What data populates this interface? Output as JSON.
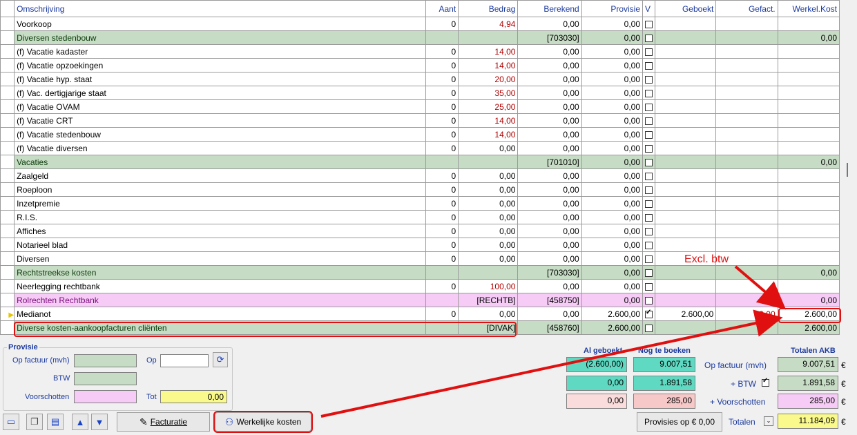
{
  "columns": [
    "Omschrijving",
    "Aant",
    "Bedrag",
    "Berekend",
    "Provisie",
    "V",
    "Geboekt",
    "Gefact.",
    "Werkel.Kost"
  ],
  "rows": [
    {
      "type": "normal",
      "desc": "Voorkoop",
      "aant": "0",
      "bedrag": "4,94",
      "bedrag_red": true,
      "berekend": "0,00",
      "provisie": "0,00",
      "v": false,
      "geboekt": "",
      "gefact": "",
      "werkel": ""
    },
    {
      "type": "cat",
      "desc": "Diversen stedenbouw",
      "aant": "",
      "bedrag": "",
      "berekend": "[703030]",
      "provisie": "0,00",
      "v": false,
      "geboekt": "",
      "gefact": "",
      "werkel": "0,00"
    },
    {
      "type": "normal",
      "desc": "(f) Vacatie kadaster",
      "aant": "0",
      "bedrag": "14,00",
      "bedrag_red": true,
      "berekend": "0,00",
      "provisie": "0,00",
      "v": false,
      "geboekt": "",
      "gefact": "",
      "werkel": ""
    },
    {
      "type": "normal",
      "desc": "(f) Vacatie opzoekingen",
      "aant": "0",
      "bedrag": "14,00",
      "bedrag_red": true,
      "berekend": "0,00",
      "provisie": "0,00",
      "v": false,
      "geboekt": "",
      "gefact": "",
      "werkel": ""
    },
    {
      "type": "normal",
      "desc": "(f) Vacatie hyp. staat",
      "aant": "0",
      "bedrag": "20,00",
      "bedrag_red": true,
      "berekend": "0,00",
      "provisie": "0,00",
      "v": false,
      "geboekt": "",
      "gefact": "",
      "werkel": ""
    },
    {
      "type": "normal",
      "desc": "(f) Vac. dertigjarige staat",
      "aant": "0",
      "bedrag": "35,00",
      "bedrag_red": true,
      "berekend": "0,00",
      "provisie": "0,00",
      "v": false,
      "geboekt": "",
      "gefact": "",
      "werkel": ""
    },
    {
      "type": "normal",
      "desc": "(f) Vacatie OVAM",
      "aant": "0",
      "bedrag": "25,00",
      "bedrag_red": true,
      "berekend": "0,00",
      "provisie": "0,00",
      "v": false,
      "geboekt": "",
      "gefact": "",
      "werkel": ""
    },
    {
      "type": "normal",
      "desc": "(f) Vacatie CRT",
      "aant": "0",
      "bedrag": "14,00",
      "bedrag_red": true,
      "berekend": "0,00",
      "provisie": "0,00",
      "v": false,
      "geboekt": "",
      "gefact": "",
      "werkel": ""
    },
    {
      "type": "normal",
      "desc": "(f) Vacatie stedenbouw",
      "aant": "0",
      "bedrag": "14,00",
      "bedrag_red": true,
      "berekend": "0,00",
      "provisie": "0,00",
      "v": false,
      "geboekt": "",
      "gefact": "",
      "werkel": ""
    },
    {
      "type": "normal",
      "desc": "(f) Vacatie diversen",
      "aant": "0",
      "bedrag": "0,00",
      "bedrag_red": false,
      "berekend": "0,00",
      "provisie": "0,00",
      "v": false,
      "geboekt": "",
      "gefact": "",
      "werkel": ""
    },
    {
      "type": "cat",
      "desc": "Vacaties",
      "aant": "",
      "bedrag": "",
      "berekend": "[701010]",
      "provisie": "0,00",
      "v": false,
      "geboekt": "",
      "gefact": "",
      "werkel": "0,00"
    },
    {
      "type": "normal",
      "desc": "Zaalgeld",
      "aant": "0",
      "bedrag": "0,00",
      "bedrag_red": false,
      "berekend": "0,00",
      "provisie": "0,00",
      "v": false,
      "geboekt": "",
      "gefact": "",
      "werkel": ""
    },
    {
      "type": "normal",
      "desc": "Roeploon",
      "aant": "0",
      "bedrag": "0,00",
      "bedrag_red": false,
      "berekend": "0,00",
      "provisie": "0,00",
      "v": false,
      "geboekt": "",
      "gefact": "",
      "werkel": ""
    },
    {
      "type": "normal",
      "desc": "Inzetpremie",
      "aant": "0",
      "bedrag": "0,00",
      "bedrag_red": false,
      "berekend": "0,00",
      "provisie": "0,00",
      "v": false,
      "geboekt": "",
      "gefact": "",
      "werkel": ""
    },
    {
      "type": "normal",
      "desc": "R.I.S.",
      "aant": "0",
      "bedrag": "0,00",
      "bedrag_red": false,
      "berekend": "0,00",
      "provisie": "0,00",
      "v": false,
      "geboekt": "",
      "gefact": "",
      "werkel": ""
    },
    {
      "type": "normal",
      "desc": "Affiches",
      "aant": "0",
      "bedrag": "0,00",
      "bedrag_red": false,
      "berekend": "0,00",
      "provisie": "0,00",
      "v": false,
      "geboekt": "",
      "gefact": "",
      "werkel": ""
    },
    {
      "type": "normal",
      "desc": "Notarieel blad",
      "aant": "0",
      "bedrag": "0,00",
      "bedrag_red": false,
      "berekend": "0,00",
      "provisie": "0,00",
      "v": false,
      "geboekt": "",
      "gefact": "",
      "werkel": ""
    },
    {
      "type": "normal",
      "desc": "Diversen",
      "aant": "0",
      "bedrag": "0,00",
      "bedrag_red": false,
      "berekend": "0,00",
      "provisie": "0,00",
      "v": false,
      "geboekt": "",
      "gefact": "",
      "werkel": ""
    },
    {
      "type": "cat",
      "desc": "Rechtstreekse kosten",
      "aant": "",
      "bedrag": "",
      "berekend": "[703030]",
      "provisie": "0,00",
      "v": false,
      "geboekt": "",
      "gefact": "",
      "werkel": "0,00"
    },
    {
      "type": "normal",
      "desc": "Neerlegging rechtbank",
      "aant": "0",
      "bedrag": "100,00",
      "bedrag_red": true,
      "berekend": "0,00",
      "provisie": "0,00",
      "v": false,
      "geboekt": "",
      "gefact": "",
      "werkel": ""
    },
    {
      "type": "pink",
      "desc": "Rolrechten Rechtbank",
      "aant": "",
      "bedrag": "[RECHTB]",
      "berekend": "[458750]",
      "provisie": "0,00",
      "v": false,
      "geboekt": "",
      "gefact": "",
      "werkel": "0,00"
    },
    {
      "type": "current",
      "desc": "Medianot",
      "aant": "0",
      "bedrag": "0,00",
      "bedrag_red": false,
      "berekend": "0,00",
      "provisie": "2.600,00",
      "v": true,
      "geboekt": "2.600,00",
      "gefact": "0,00",
      "werkel": "2.600,00"
    },
    {
      "type": "cat",
      "desc": "Diverse kosten-aankoopfacturen cliënten",
      "aant": "",
      "bedrag": "[DIVAK]",
      "berekend": "[458760]",
      "provisie": "2.600,00",
      "v": false,
      "geboekt": "",
      "gefact": "",
      "werkel": "2.600,00"
    }
  ],
  "provisie": {
    "title": "Provisie",
    "op_factuur_label": "Op factuur (mvh)",
    "op_label": "Op",
    "btw_label": "BTW",
    "voorschotten_label": "Voorschotten",
    "tot_label": "Tot",
    "tot_value": "0,00"
  },
  "totals": {
    "al_geboekt_header": "Al geboekt",
    "nog_te_boeken_header": "Nog te boeken",
    "totalen_akb_header": "Totalen AKB",
    "row_labels": [
      "Op factuur (mvh)",
      "+ BTW",
      "+ Voorschotten"
    ],
    "al_geboekt": [
      "(2.600,00)",
      "0,00",
      "0,00"
    ],
    "nog_te_boeken": [
      "9.007,51",
      "1.891,58",
      "285,00"
    ],
    "totalen": [
      "9.007,51",
      "1.891,58",
      "285,00"
    ],
    "currency": "€",
    "totalen_label": "Totalen",
    "totalen_value": "11.184,09"
  },
  "toolbar": {
    "facturatie_label": "Facturatie",
    "werkelijke_kosten_label": "Werkelijke kosten",
    "provisies_op_label": "Provisies op € 0,00"
  },
  "annotation": {
    "text": "Excl. btw"
  },
  "colors": {
    "category_green": "#c6dcc4",
    "pink": "#f6ccf6",
    "teal": "#5fd9c2",
    "yellow": "#fafa8c",
    "annotation_red": "#e01010"
  }
}
